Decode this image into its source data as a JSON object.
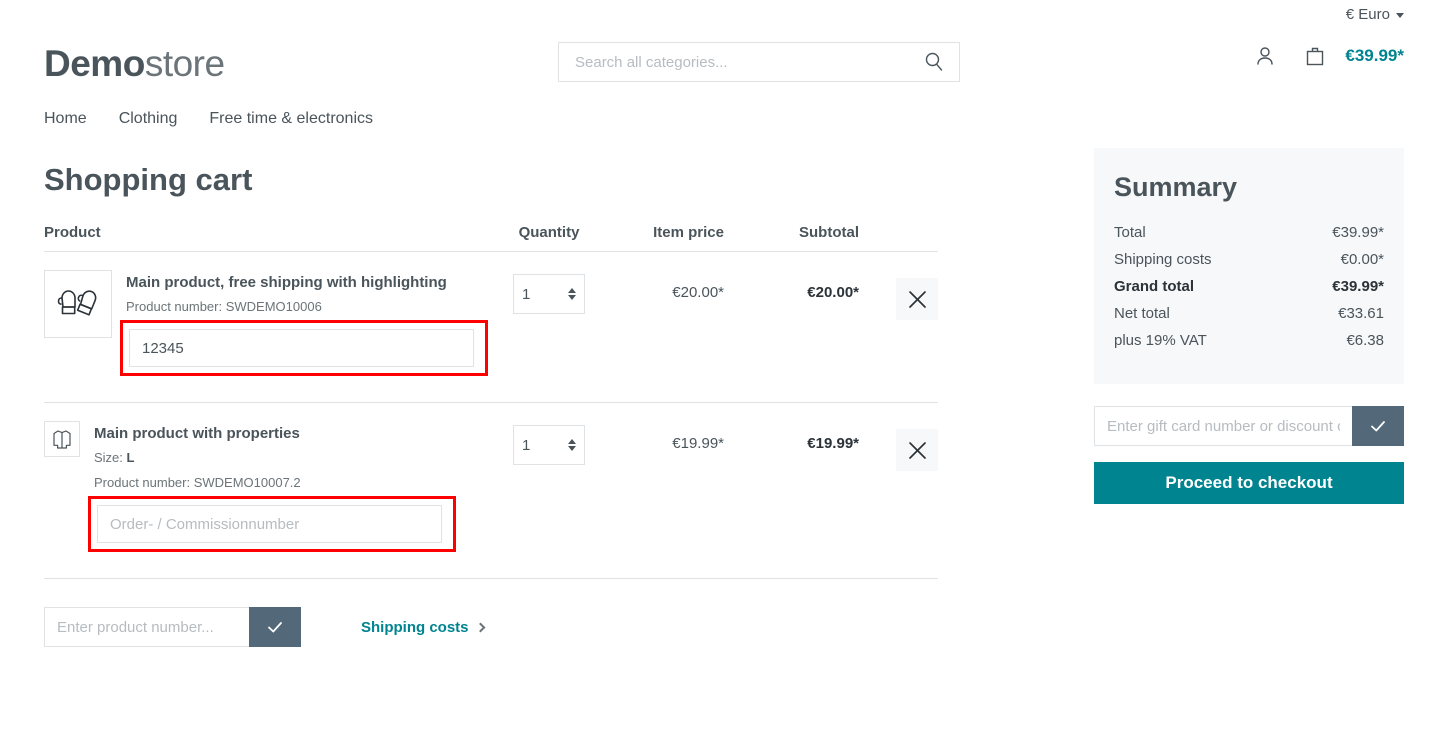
{
  "topbar": {
    "currency_label": "€ Euro"
  },
  "header": {
    "logo_bold": "Demo",
    "logo_light": "store",
    "search_placeholder": "Search all categories...",
    "search_value": "",
    "cart_total": "€39.99*"
  },
  "nav": {
    "items": [
      {
        "label": "Home"
      },
      {
        "label": "Clothing"
      },
      {
        "label": "Free time & electronics"
      }
    ]
  },
  "cart": {
    "title": "Shopping cart",
    "columns": {
      "product": "Product",
      "quantity": "Quantity",
      "item_price": "Item price",
      "subtotal": "Subtotal"
    },
    "rows": [
      {
        "name": "Main product, free shipping with highlighting",
        "product_number_label": "Product number: SWDEMO10006",
        "property_label": "",
        "property_value": "",
        "quantity": "1",
        "item_price": "€20.00*",
        "subtotal": "€20.00*",
        "commission_value": "12345",
        "commission_placeholder": "Order- / Commissionnumber",
        "icon": "mittens-icon",
        "highlighted": true
      },
      {
        "name": "Main product with properties",
        "product_number_label": "Product number: SWDEMO10007.2",
        "property_label": "Size:",
        "property_value": "L",
        "quantity": "1",
        "item_price": "€19.99*",
        "subtotal": "€19.99*",
        "commission_value": "",
        "commission_placeholder": "Order- / Commissionnumber",
        "icon": "jacket-icon",
        "highlighted": true
      }
    ],
    "product_number_placeholder": "Enter product number...",
    "product_number_value": "",
    "shipping_costs_link": "Shipping costs"
  },
  "summary": {
    "title": "Summary",
    "rows": [
      {
        "label": "Total",
        "value": "€39.99*",
        "strong": false
      },
      {
        "label": "Shipping costs",
        "value": "€0.00*",
        "strong": false
      },
      {
        "label": "Grand total",
        "value": "€39.99*",
        "strong": true
      },
      {
        "label": "Net total",
        "value": "€33.61",
        "strong": false
      },
      {
        "label": "plus 19% VAT",
        "value": "€6.38",
        "strong": false
      }
    ],
    "gift_placeholder": "Enter gift card number or discount code...",
    "gift_value": "",
    "checkout_label": "Proceed to checkout"
  },
  "colors": {
    "accent_teal": "#008490",
    "slate_button": "#53697a",
    "highlight_red": "#ff0000",
    "text": "#4a545b",
    "panel_bg": "#f7f8f9"
  }
}
